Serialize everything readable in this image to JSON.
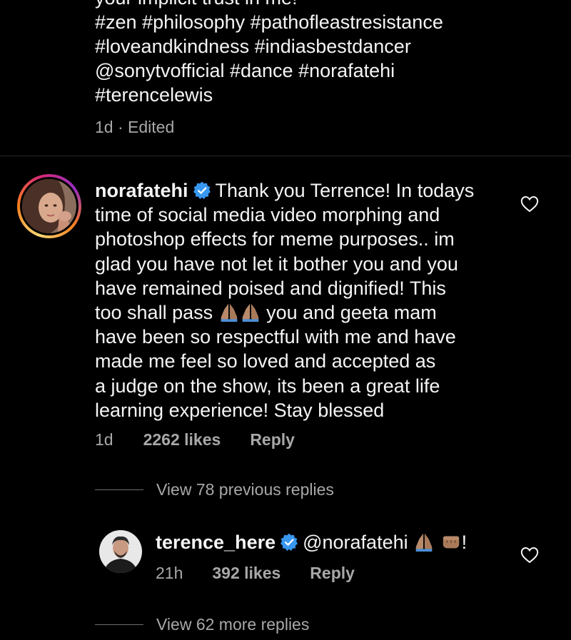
{
  "caption": {
    "lines": [
      "your implicit trust in me!",
      "#zen #philosophy #pathofleastresistance",
      "#loveandkindness #indiasbestdancer",
      "@sonytvofficial #dance #norafatehi",
      "#terencelewis"
    ],
    "time": "1d",
    "separator": "·",
    "edited": "Edited"
  },
  "comment": {
    "username": "norafatehi",
    "verified": true,
    "lines": [
      "Thank you Terrence! In todays",
      "time of social media video morphing and",
      "photoshop effects for meme purposes.. im",
      "glad you have not let it bother you and you",
      "have remained poised and dignified! This",
      "too shall pass",
      "you and geeta mam",
      "have been so respectful with me and have",
      "made me feel so loved and accepted as",
      "a judge on the show, its been a great life",
      "learning experience! Stay blessed"
    ],
    "time": "1d",
    "likes": "2262 likes",
    "reply_label": "Reply",
    "emojis": [
      "folded-hands-icon",
      "folded-hands-icon"
    ]
  },
  "view_previous_replies": "View 78 previous replies",
  "reply": {
    "username": "terence_here",
    "verified": true,
    "mention": "@norafatehi",
    "suffix": "!",
    "time": "21h",
    "likes": "392 likes",
    "reply_label": "Reply",
    "emojis": [
      "folded-hands-icon",
      "oncoming-fist-icon"
    ]
  },
  "view_more_replies": "View 62 more replies",
  "colors": {
    "background": "#000000",
    "text": "#f5f5f5",
    "muted": "#a8a8a8",
    "verified_blue": "#3897f0",
    "divider": "#262626"
  }
}
